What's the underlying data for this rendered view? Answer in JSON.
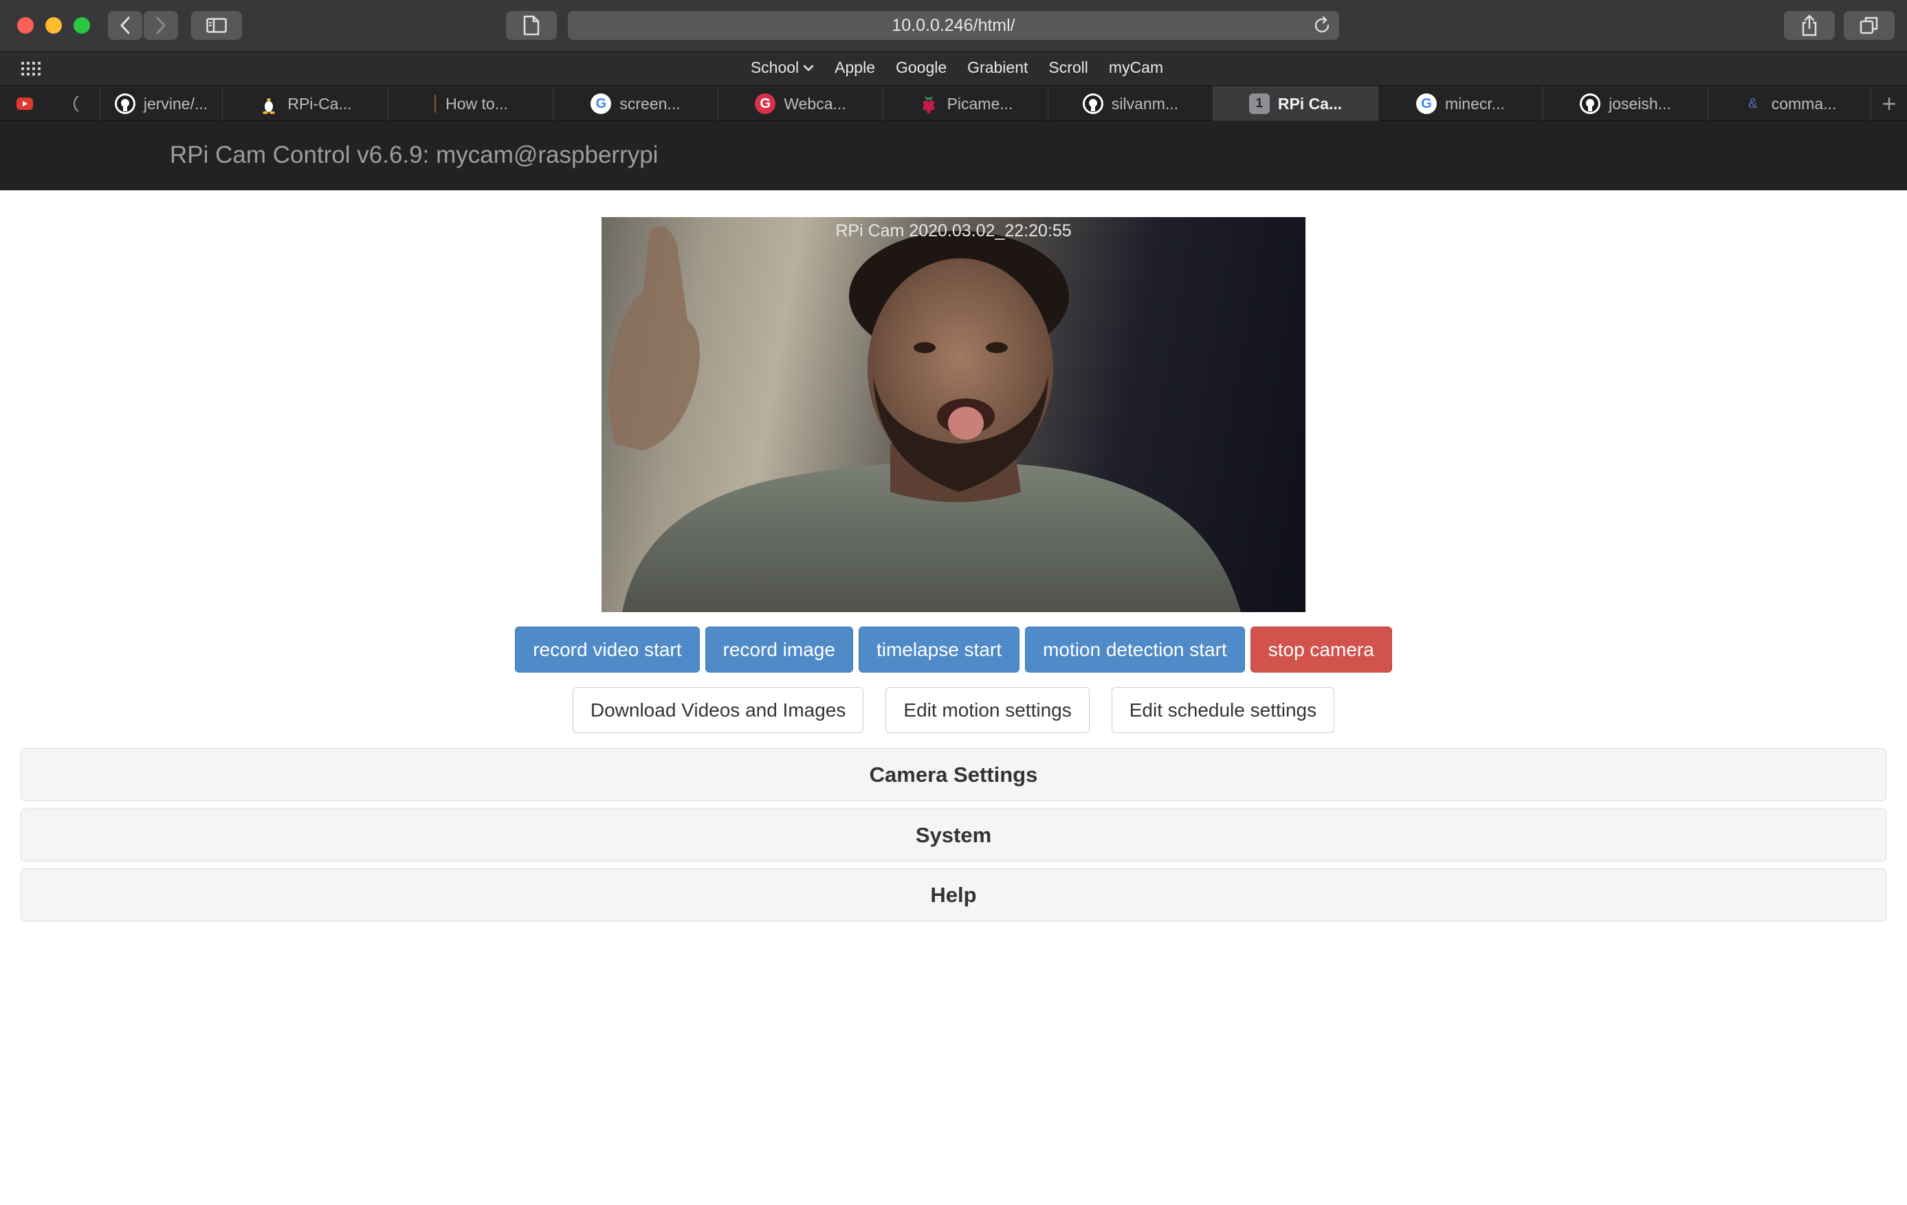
{
  "browser": {
    "url": "10.0.0.246/html/",
    "favorites": [
      {
        "label": "School",
        "has_chevron": true
      },
      {
        "label": "Apple"
      },
      {
        "label": "Google"
      },
      {
        "label": "Grabient"
      },
      {
        "label": "Scroll"
      },
      {
        "label": "myCam"
      }
    ],
    "tabs": [
      {
        "label": "jervine/...",
        "icon": "github-icon"
      },
      {
        "label": "RPi-Ca...",
        "icon": "linux-penguin-icon"
      },
      {
        "label": "How to...",
        "icon": "page-icon"
      },
      {
        "label": "screen...",
        "icon": "google-icon"
      },
      {
        "label": "Webca...",
        "icon": "webcam-g-icon"
      },
      {
        "label": "Picame...",
        "icon": "raspberry-icon"
      },
      {
        "label": "silvanm...",
        "icon": "github-icon"
      },
      {
        "label": "RPi Ca...",
        "icon": "number-1-icon",
        "badge": "1",
        "active": true
      },
      {
        "label": "minecr...",
        "icon": "google-icon"
      },
      {
        "label": "joseish...",
        "icon": "github-icon"
      },
      {
        "label": "comma...",
        "icon": "ampersand-icon",
        "badge": "&"
      }
    ]
  },
  "page": {
    "title": "RPi Cam Control v6.6.9: mycam@raspberrypi",
    "camera_overlay": "RPi Cam  2020.03.02_22:20:55",
    "action_buttons": {
      "record_video": "record video start",
      "record_image": "record image",
      "timelapse": "timelapse start",
      "motion_detection": "motion detection start",
      "stop_camera": "stop camera"
    },
    "secondary_buttons": {
      "download": "Download Videos and Images",
      "edit_motion": "Edit motion settings",
      "edit_schedule": "Edit schedule settings"
    },
    "panels": {
      "camera_settings": "Camera Settings",
      "system": "System",
      "help": "Help"
    }
  },
  "colors": {
    "navbar": "#222222",
    "primary_button": "#4f8ac9",
    "danger_button": "#d2524c",
    "panel_background": "#f5f5f5"
  }
}
